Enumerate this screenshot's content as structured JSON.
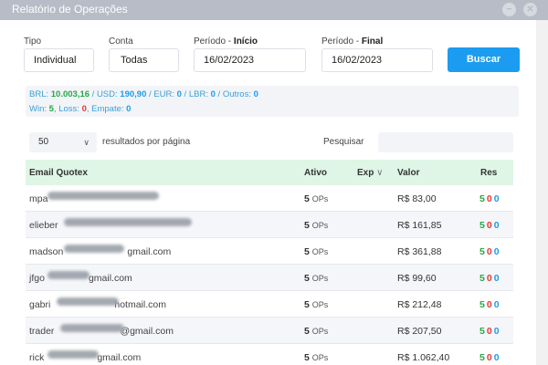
{
  "window": {
    "title": "Relatório de Operações"
  },
  "filters": {
    "tipo_label": "Tipo",
    "tipo_value": "Individual",
    "conta_label": "Conta",
    "conta_value": "Todas",
    "inicio_label_prefix": "Período - ",
    "inicio_label_strong": "Início",
    "inicio_value": "16/02/2023",
    "final_label_prefix": "Período - ",
    "final_label_strong": "Final",
    "final_value": "16/02/2023",
    "search_button": "Buscar"
  },
  "summary": {
    "brl_label": "BRL: ",
    "brl_value": "10.003,16",
    "usd_label": " / USD: ",
    "usd_value": "190,90",
    "eur_label": " / EUR: ",
    "eur_value": "0",
    "lbr_label": " / LBR: ",
    "lbr_value": "0",
    "outros_label": " / Outros: ",
    "outros_value": "0",
    "win_label": "Win: ",
    "win_value": "5",
    "loss_label": ", Loss: ",
    "loss_value": "0",
    "empate_label": ", Empate: ",
    "empate_value": "0"
  },
  "table_controls": {
    "per_page_value": "50",
    "per_page_label": "resultados por página",
    "search_label": "Pesquisar",
    "search_value": ""
  },
  "table": {
    "headers": {
      "email": "Email Quotex",
      "ativo": "Ativo",
      "exp": "Exp",
      "valor": "Valor",
      "res": "Res"
    },
    "rows": [
      {
        "email": "mpa",
        "ativo_num": "5",
        "ativo_unit": "OPs",
        "valor": "R$ 83,00",
        "res_w": "5",
        "res_l": "0",
        "res_e": "0"
      },
      {
        "email": "elieber",
        "ativo_num": "5",
        "ativo_unit": "OPs",
        "valor": "R$ 161,85",
        "res_w": "5",
        "res_l": "0",
        "res_e": "0"
      },
      {
        "email": "madson",
        "ativo_num": "5",
        "ativo_unit": "OPs",
        "valor": "R$ 361,88",
        "res_w": "5",
        "res_l": "0",
        "res_e": "0"
      },
      {
        "email": "jfgo",
        "ativo_num": "5",
        "ativo_unit": "OPs",
        "valor": "R$ 99,60",
        "res_w": "5",
        "res_l": "0",
        "res_e": "0"
      },
      {
        "email": "gabri",
        "ativo_num": "5",
        "ativo_unit": "OPs",
        "valor": "R$ 212,48",
        "res_w": "5",
        "res_l": "0",
        "res_e": "0"
      },
      {
        "email": "trader",
        "ativo_num": "5",
        "ativo_unit": "OPs",
        "valor": "R$ 207,50",
        "res_w": "5",
        "res_l": "0",
        "res_e": "0"
      },
      {
        "email": "rick",
        "ativo_num": "5",
        "ativo_unit": "OPs",
        "valor": "R$ 1.062,40",
        "res_w": "5",
        "res_l": "0",
        "res_e": "0"
      }
    ],
    "email_suffix_visible": [
      "",
      "",
      "gmail.com",
      "gmail.com",
      "hotmail.com",
      "@gmail.com",
      "gmail.com"
    ]
  },
  "colors": {
    "accent": "#1b9cf0",
    "win": "#28a745",
    "loss": "#e53935",
    "header_bg": "#dff6e6"
  },
  "icons": {
    "window_minimize": "minimize-icon",
    "window_close": "close-icon",
    "sort": "chevron-down-icon"
  }
}
